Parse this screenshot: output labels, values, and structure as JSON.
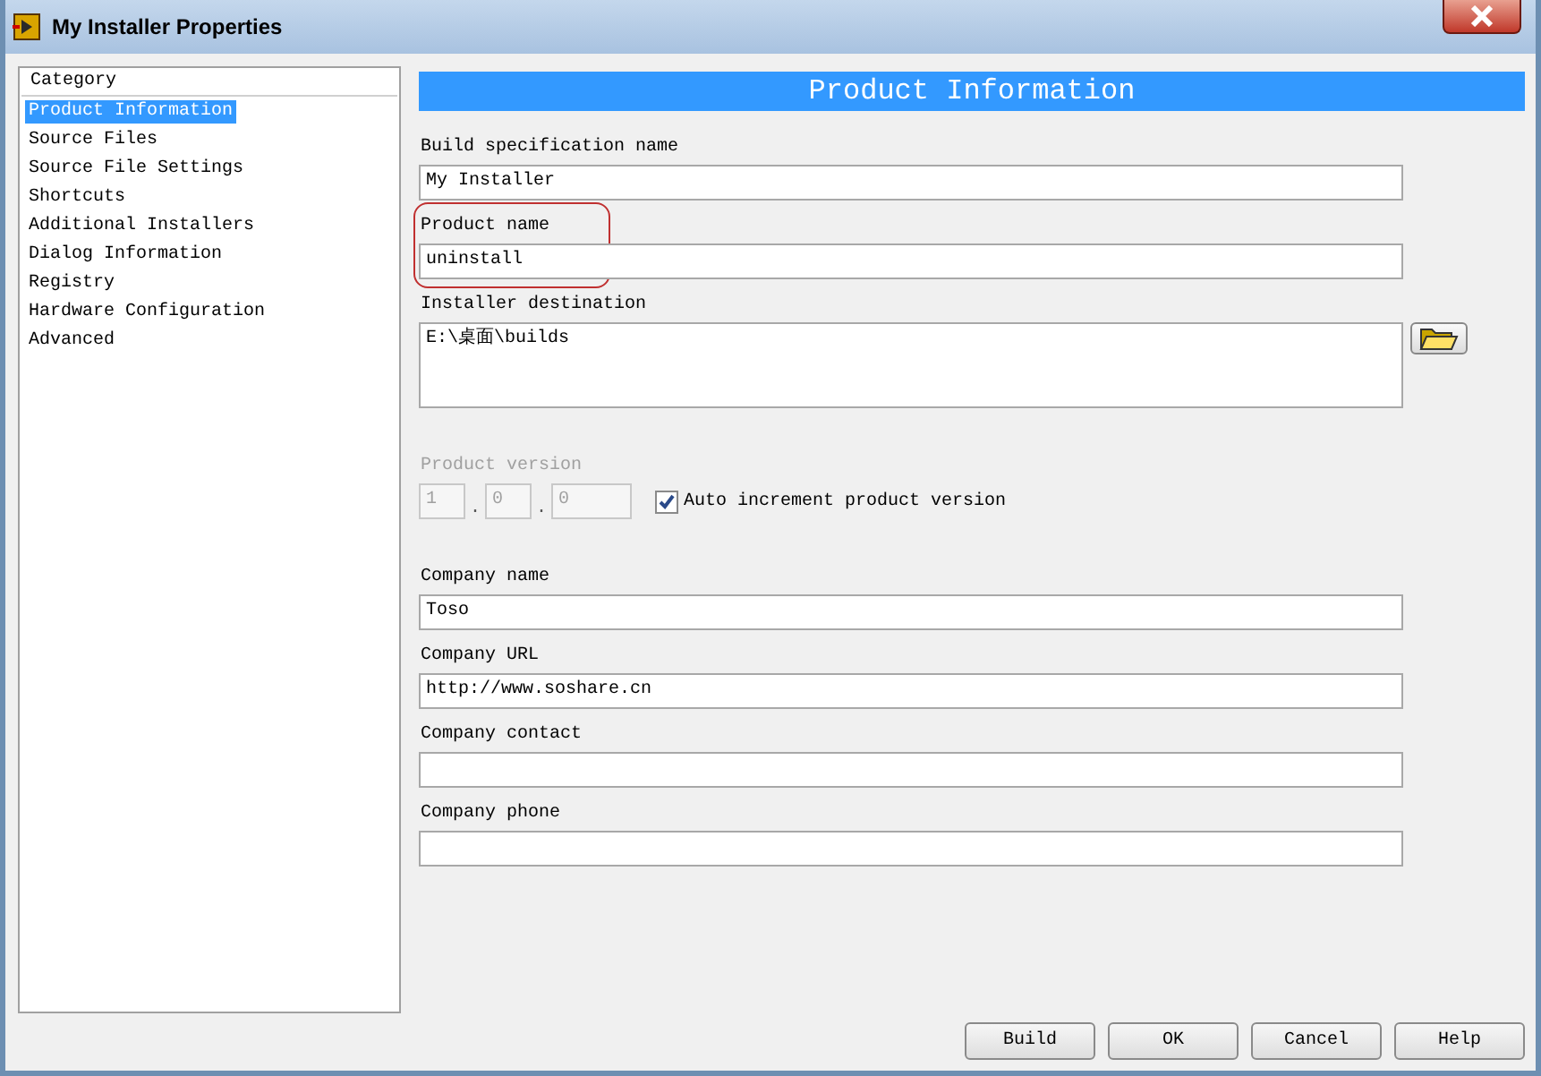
{
  "window": {
    "title": "My Installer Properties"
  },
  "category_list": {
    "header": "Category",
    "items": [
      {
        "label": "Product Information",
        "selected": true
      },
      {
        "label": "Source Files",
        "selected": false
      },
      {
        "label": "Source File Settings",
        "selected": false
      },
      {
        "label": "Shortcuts",
        "selected": false
      },
      {
        "label": "Additional Installers",
        "selected": false
      },
      {
        "label": "Dialog Information",
        "selected": false
      },
      {
        "label": "Registry",
        "selected": false
      },
      {
        "label": "Hardware Configuration",
        "selected": false
      },
      {
        "label": "Advanced",
        "selected": false
      }
    ]
  },
  "panel": {
    "title": "Product Information",
    "fields": [
      {
        "kind": "text",
        "label": "Build specification name",
        "value": "My Installer"
      },
      {
        "kind": "text",
        "label": "Product name",
        "value": "uninstall",
        "highlighted": true
      },
      {
        "kind": "path",
        "label": "Installer destination",
        "value": "E:\\桌面\\builds"
      },
      {
        "kind": "version",
        "label": "Product version",
        "disabled": true,
        "parts": [
          "1",
          "0",
          "0"
        ],
        "separator": ".",
        "checkbox": {
          "label": "Auto increment product version",
          "checked": true
        }
      },
      {
        "kind": "text",
        "label": "Company name",
        "value": "Toso"
      },
      {
        "kind": "text",
        "label": "Company URL",
        "value": "http://www.soshare.cn"
      },
      {
        "kind": "text",
        "label": "Company contact"
      },
      {
        "kind": "text",
        "label": "Company phone"
      }
    ]
  },
  "buttons": [
    "Build",
    "OK",
    "Cancel",
    "Help"
  ]
}
